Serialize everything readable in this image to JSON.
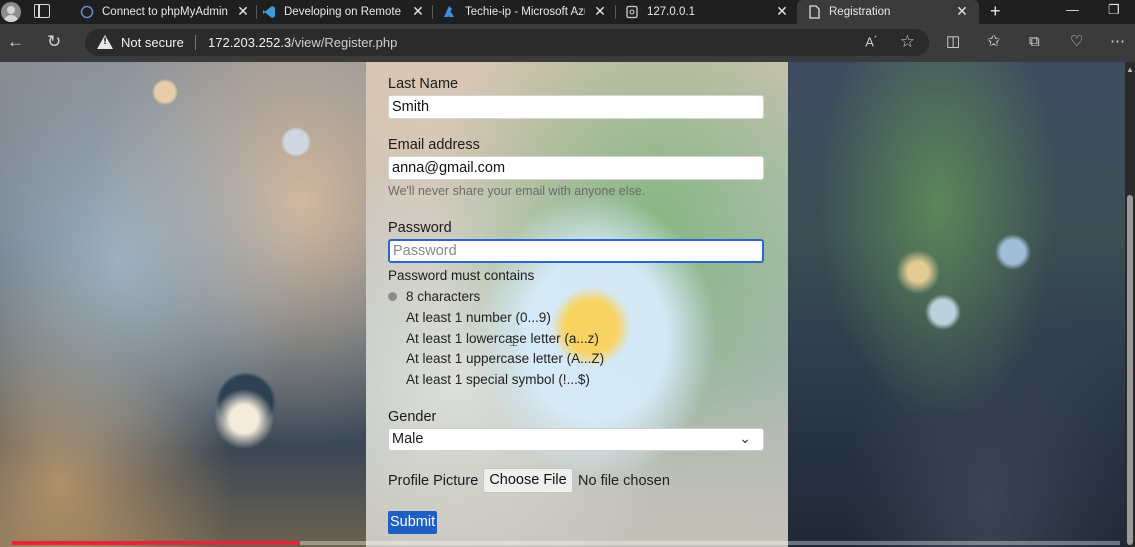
{
  "browser": {
    "tabs": [
      {
        "label": "Connect to phpMyAdmin",
        "icon": "phpmyadmin-icon"
      },
      {
        "label": "Developing on Remote Machines",
        "icon": "vscode-icon"
      },
      {
        "label": "Techie-ip - Microsoft Azure",
        "icon": "azure-icon"
      },
      {
        "label": "127.0.0.1",
        "icon": "page-icon"
      },
      {
        "label": "Registration",
        "icon": "document-icon",
        "active": true
      }
    ],
    "address": {
      "security_label": "Not secure",
      "url_host": "172.203.252.3",
      "url_path": "/view/Register.php"
    }
  },
  "form": {
    "last_name_label": "Last Name",
    "last_name_value": "Smith",
    "email_label": "Email address",
    "email_value": "anna@gmail.com",
    "email_help": "We'll never share your email with anyone else.",
    "password_label": "Password",
    "password_placeholder": "Password",
    "password_rules_title": "Password must contains",
    "password_rules": [
      "8 characters",
      "At least 1 number (0...9)",
      "At least 1 lowercase letter (a...z)",
      "At least 1 uppercase letter (A...Z)",
      "At least 1 special symbol (!...$)"
    ],
    "gender_label": "Gender",
    "gender_value": "Male",
    "picture_label": "Profile Picture",
    "choose_file_label": "Choose File",
    "no_file_text": "No file chosen",
    "submit_label": "Submit"
  },
  "video_progress": 0.26,
  "colors": {
    "accent": "#2b67c9",
    "submit": "#1f5fc4",
    "progress": "#e8243a"
  }
}
